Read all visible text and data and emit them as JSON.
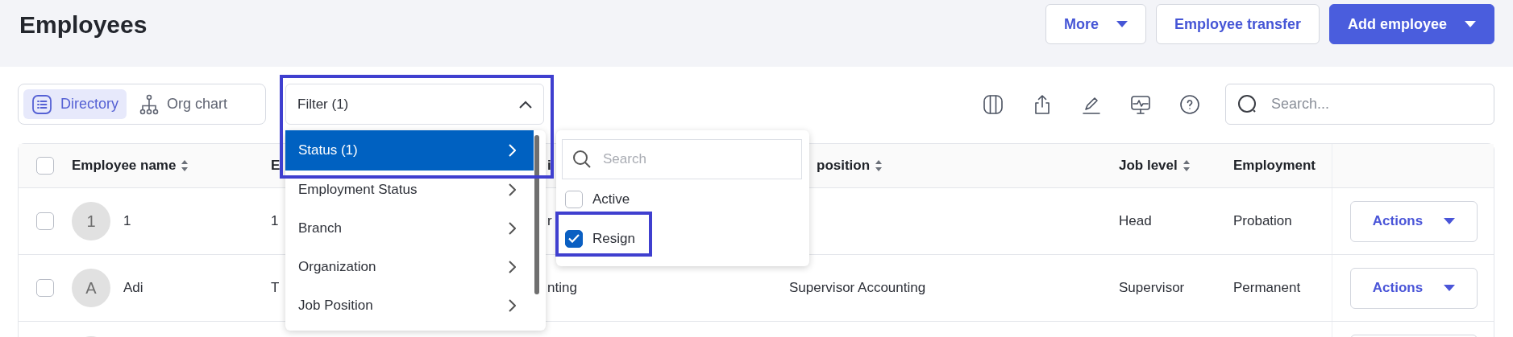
{
  "page": {
    "title": "Employees"
  },
  "header_buttons": [
    {
      "label": "More",
      "kind": "dropdown",
      "primary": false
    },
    {
      "label": "Employee transfer",
      "kind": "plain",
      "primary": false
    },
    {
      "label": "Add employee",
      "kind": "dropdown",
      "primary": true
    }
  ],
  "view_toggle": [
    {
      "label": "Directory",
      "kind": "list",
      "selected": true
    },
    {
      "label": "Org chart",
      "kind": "tree",
      "selected": false
    }
  ],
  "filter": {
    "label": "Filter (1)",
    "expanded": true,
    "highlighted": true,
    "menu": [
      {
        "label": "Status (1)",
        "selected": true
      },
      {
        "label": "Employment Status",
        "selected": false
      },
      {
        "label": "Branch",
        "selected": false
      },
      {
        "label": "Organization",
        "selected": false
      },
      {
        "label": "Job Position",
        "selected": false
      }
    ],
    "submenu": {
      "placeholder": "Search",
      "options": [
        {
          "label": "Active",
          "checked": false,
          "highlighted": false
        },
        {
          "label": "Resign",
          "checked": true,
          "highlighted": true
        }
      ]
    }
  },
  "search": {
    "placeholder": "Search..."
  },
  "table": {
    "select_all": {
      "checked": false
    },
    "columns": [
      {
        "label": "Employee name",
        "sortable": true
      },
      {
        "label": "E"
      },
      {
        "label": "i"
      },
      {
        "label": "position",
        "sortable": true
      },
      {
        "label": "Job level",
        "sortable": true
      },
      {
        "label": "Employment",
        "sortable": false
      }
    ],
    "rows": [
      {
        "kind": "full",
        "checked": false,
        "avatar": "1",
        "name": "1",
        "column_2": "1",
        "column_3": "r",
        "job_level": "Head",
        "employment": "Probation",
        "action": "Actions"
      },
      {
        "kind": "full",
        "checked": false,
        "avatar": "A",
        "name": "Adi",
        "column_2": "T",
        "column_3": "nting",
        "job_position": "Supervisor Accounting",
        "job_level": "Supervisor",
        "employment": "Permanent",
        "action": "Actions"
      },
      {
        "kind": "cut_off"
      }
    ]
  }
}
